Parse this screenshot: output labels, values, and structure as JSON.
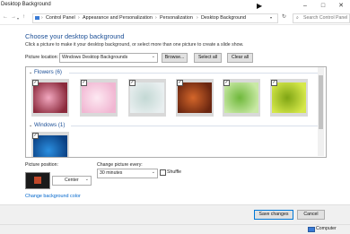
{
  "window": {
    "title": "Desktop Background"
  },
  "address": {
    "breadcrumbs": [
      "Control Panel",
      "Appearance and Personalization",
      "Personalization",
      "Desktop Background"
    ],
    "search_placeholder": "Search Control Panel"
  },
  "main": {
    "heading": "Choose your desktop background",
    "subtext": "Click a picture to make it your desktop background, or select more than one picture to create a slide show.",
    "picture_location_label": "Picture location:",
    "picture_location_value": "Windows Desktop Backgrounds",
    "browse_label": "Browse...",
    "select_all_label": "Select all",
    "clear_all_label": "Clear all"
  },
  "groups": [
    {
      "name": "Flowers (6)",
      "thumbnails": [
        {
          "checked": true,
          "colors": [
            "#8b2a3c",
            "#f2a8c0"
          ]
        },
        {
          "checked": true,
          "colors": [
            "#f1b6d2",
            "#fde9f2"
          ]
        },
        {
          "checked": true,
          "colors": [
            "#e9eff0",
            "#c3d8d4"
          ]
        },
        {
          "checked": true,
          "colors": [
            "#6a2610",
            "#d4662a"
          ]
        },
        {
          "checked": true,
          "colors": [
            "#c9e9a5",
            "#6fb83b"
          ]
        },
        {
          "checked": true,
          "colors": [
            "#d6e84a",
            "#7fa514"
          ]
        }
      ]
    },
    {
      "name": "Windows (1)",
      "thumbnails": [
        {
          "checked": true,
          "colors": [
            "#0a3f82",
            "#2b8fe0"
          ]
        }
      ]
    }
  ],
  "position": {
    "label": "Picture position:",
    "value": "Center"
  },
  "interval": {
    "label": "Change picture every:",
    "value": "30 minutes"
  },
  "shuffle": {
    "label": "Shuffle",
    "checked": false
  },
  "link": {
    "label": "Change background color"
  },
  "footer": {
    "save_label": "Save changes",
    "cancel_label": "Cancel"
  },
  "statusbar": {
    "computer_label": "Computer"
  }
}
